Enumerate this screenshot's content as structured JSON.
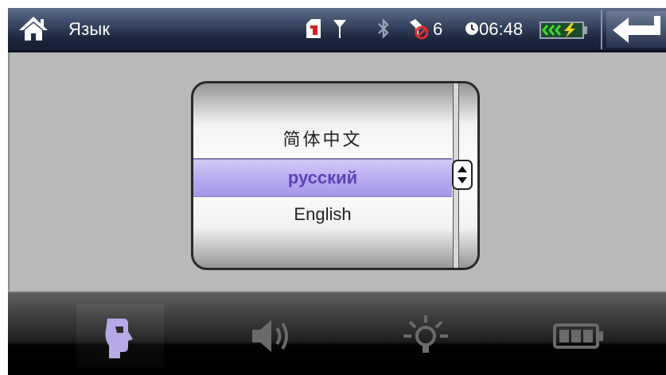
{
  "window": {
    "title": "Язык"
  },
  "status": {
    "satellite_count": "6",
    "time": "06:48",
    "icons": [
      "home-icon",
      "sim-icon",
      "antenna-icon",
      "bluetooth-icon",
      "no-satellite-icon",
      "clock-icon",
      "battery-charging-icon",
      "back-arrow-icon"
    ]
  },
  "language_picker": {
    "options": [
      "简体中文",
      "русский",
      "English"
    ],
    "selected": "русский"
  },
  "toolbar": {
    "buttons": [
      "language-icon",
      "volume-icon",
      "brightness-icon",
      "power-battery-icon"
    ],
    "active": "language-icon"
  },
  "colors": {
    "status_bar": "#1d2740",
    "background": "#b9b9b9",
    "selection": "#b8aaf0",
    "selection_text": "#5a43b5",
    "battery_accent": "#3fdc2e",
    "toolbar": "#1e1e1e",
    "active_icon": "#b7a8e8"
  }
}
